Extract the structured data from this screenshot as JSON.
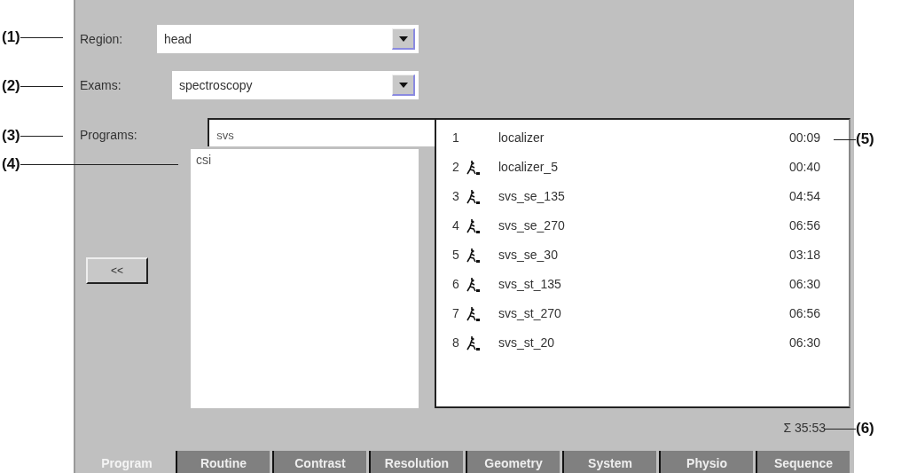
{
  "callouts": [
    {
      "label": "(1)"
    },
    {
      "label": "(2)"
    },
    {
      "label": "(3)"
    },
    {
      "label": "(4)"
    },
    {
      "label": "(5)"
    },
    {
      "label": "(6)"
    }
  ],
  "region": {
    "label": "Region:",
    "value": "head"
  },
  "exams": {
    "label": "Exams:",
    "value": "spectroscopy"
  },
  "programs": {
    "label": "Programs:",
    "filter": "svs",
    "available": [
      {
        "name": "csi",
        "selected": false
      }
    ],
    "move_button": "<<",
    "protocols": [
      {
        "number": "1",
        "icon": false,
        "name": "localizer",
        "duration": "00:09"
      },
      {
        "number": "2",
        "icon": true,
        "name": "localizer_5",
        "duration": "00:40"
      },
      {
        "number": "3",
        "icon": true,
        "name": "svs_se_135",
        "duration": "04:54"
      },
      {
        "number": "4",
        "icon": true,
        "name": "svs_se_270",
        "duration": "06:56"
      },
      {
        "number": "5",
        "icon": true,
        "name": "svs_se_30",
        "duration": "03:18"
      },
      {
        "number": "6",
        "icon": true,
        "name": "svs_st_135",
        "duration": "06:30"
      },
      {
        "number": "7",
        "icon": true,
        "name": "svs_st_270",
        "duration": "06:56"
      },
      {
        "number": "8",
        "icon": true,
        "name": "svs_st_20",
        "duration": "06:30"
      }
    ]
  },
  "total": "Σ 35:53",
  "tabs": [
    {
      "label": "Program",
      "selected": true
    },
    {
      "label": "Routine",
      "selected": false
    },
    {
      "label": "Contrast",
      "selected": false
    },
    {
      "label": "Resolution",
      "selected": false
    },
    {
      "label": "Geometry",
      "selected": false
    },
    {
      "label": "System",
      "selected": false
    },
    {
      "label": "Physio",
      "selected": false
    },
    {
      "label": "Sequence",
      "selected": false
    }
  ]
}
